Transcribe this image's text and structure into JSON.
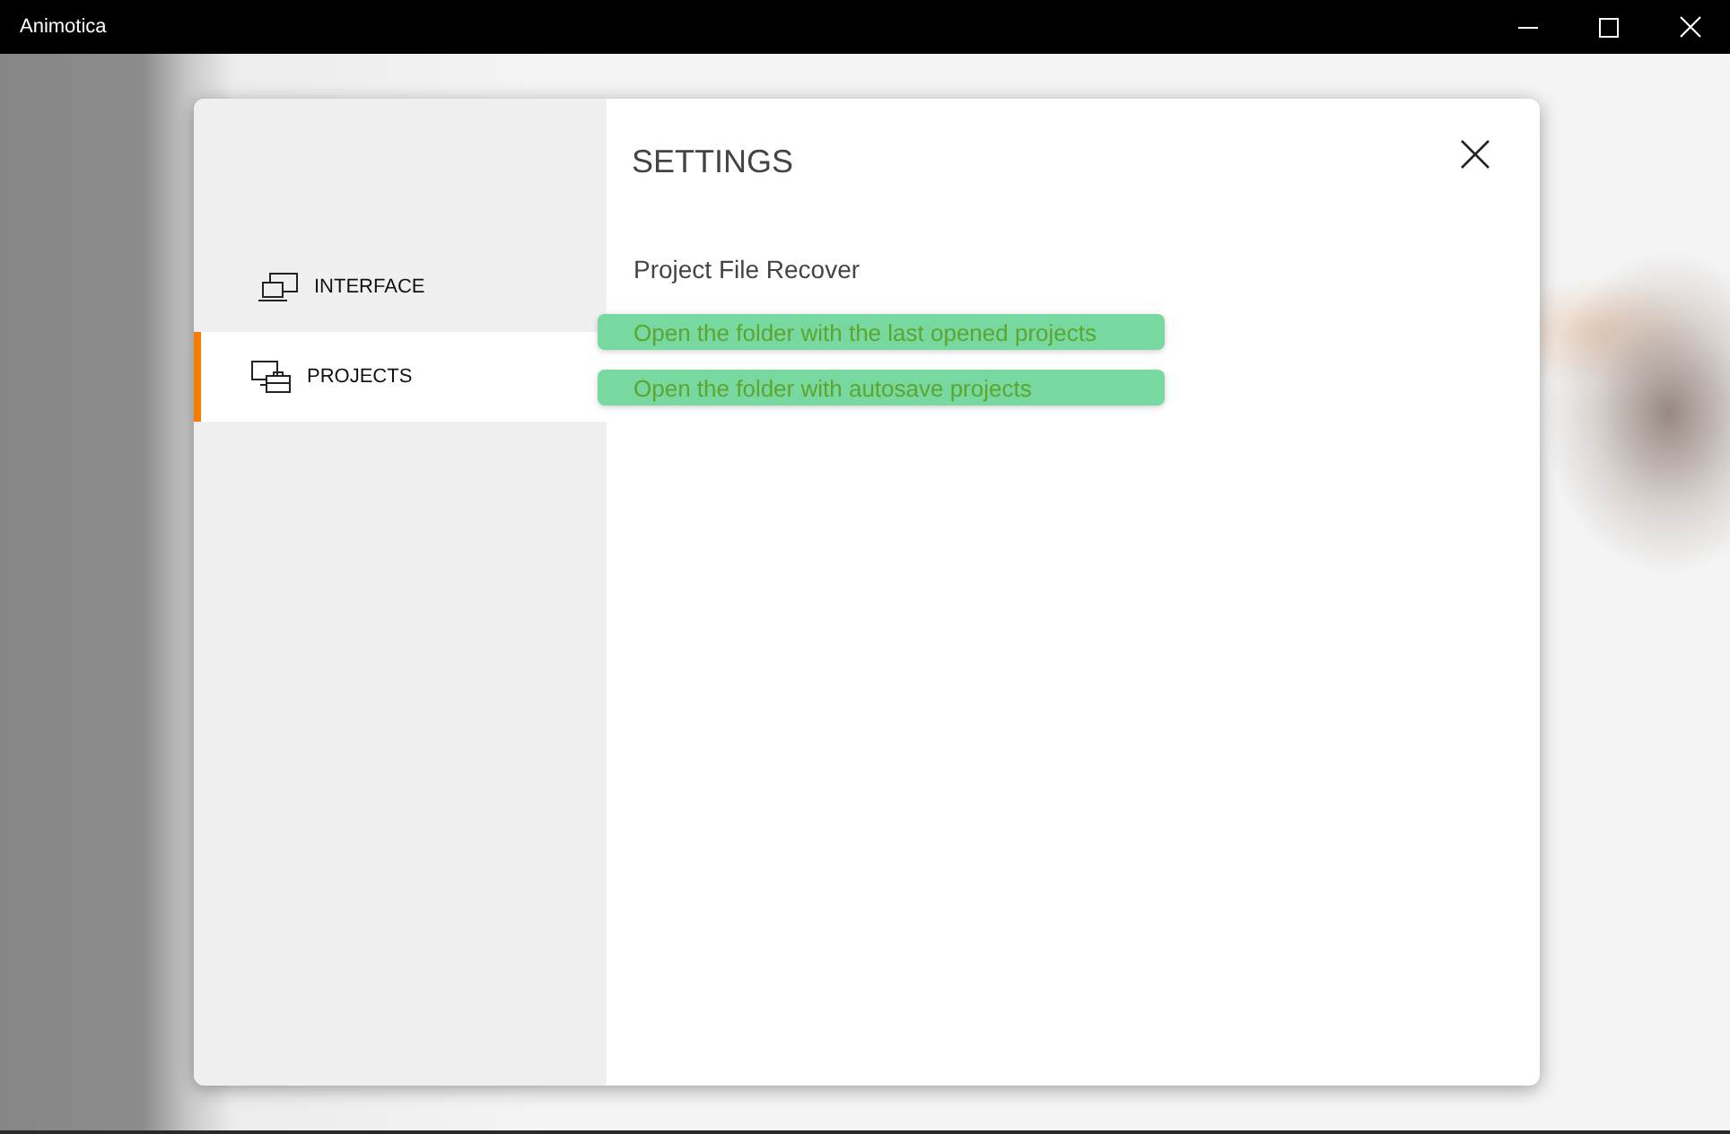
{
  "window": {
    "title": "Animotica"
  },
  "dialog": {
    "title": "SETTINGS",
    "sidebar": {
      "items": [
        {
          "label": "INTERFACE",
          "selected": false
        },
        {
          "label": "PROJECTS",
          "selected": true
        }
      ]
    },
    "section": {
      "heading": "Project File Recover",
      "buttons": [
        "Open the folder with the last opened projects",
        "Open the folder with autosave projects"
      ]
    }
  }
}
